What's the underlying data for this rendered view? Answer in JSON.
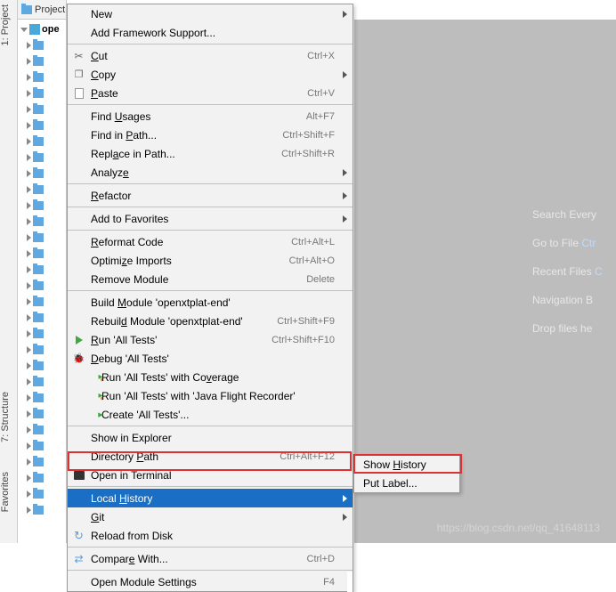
{
  "sidebar": {
    "project": "1: Project",
    "structure": "7: Structure",
    "favorites": "Favorites"
  },
  "panel": {
    "title": "Project",
    "root": "ope"
  },
  "menu": {
    "new": "New",
    "addFramework": "Add Framework Support...",
    "cut": "Cut",
    "cut_k": "Ctrl+X",
    "copy": "Copy",
    "paste": "Paste",
    "paste_k": "Ctrl+V",
    "findUsages": "Find Usages",
    "findUsages_k": "Alt+F7",
    "findInPath": "Find in Path...",
    "findInPath_k": "Ctrl+Shift+F",
    "replaceInPath": "Replace in Path...",
    "replaceInPath_k": "Ctrl+Shift+R",
    "analyze": "Analyze",
    "refactor": "Refactor",
    "addToFavorites": "Add to Favorites",
    "reformat": "Reformat Code",
    "reformat_k": "Ctrl+Alt+L",
    "optimize": "Optimize Imports",
    "optimize_k": "Ctrl+Alt+O",
    "removeModule": "Remove Module",
    "removeModule_k": "Delete",
    "buildModule": "Build Module 'openxtplat-end'",
    "rebuildModule": "Rebuild Module 'openxtplat-end'",
    "rebuildModule_k": "Ctrl+Shift+F9",
    "run": "Run 'All Tests'",
    "run_k": "Ctrl+Shift+F10",
    "debug": "Debug 'All Tests'",
    "runCoverage": "Run 'All Tests' with Coverage",
    "runJFR": "Run 'All Tests' with 'Java Flight Recorder'",
    "createRun": "Create 'All Tests'...",
    "showInExplorer": "Show in Explorer",
    "directoryPath": "Directory Path",
    "directoryPath_k": "Ctrl+Alt+F12",
    "openInTerminal": "Open in Terminal",
    "localHistory": "Local History",
    "git": "Git",
    "reloadFromDisk": "Reload from Disk",
    "compareWith": "Compare With...",
    "compareWith_k": "Ctrl+D",
    "openModuleSettings": "Open Module Settings",
    "openModuleSettings_k": "F4"
  },
  "submenu": {
    "showHistory": "Show History",
    "putLabel": "Put Label..."
  },
  "empty": {
    "search": "Search Every",
    "gotoFile": "Go to File ",
    "gotoFile_link": "Ctr",
    "recentFiles": "Recent Files ",
    "recentFiles_link": "C",
    "navBar": "Navigation B",
    "drop": "Drop files he"
  },
  "watermark": "https://blog.csdn.net/qq_41648113"
}
